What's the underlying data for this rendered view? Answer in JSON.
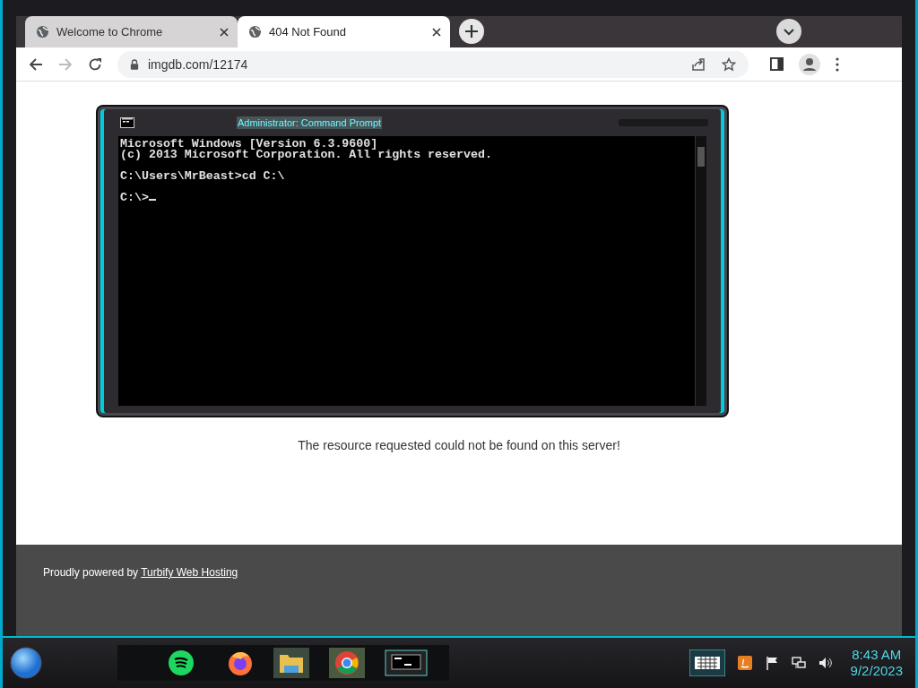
{
  "tabs": [
    {
      "title": "Welcome to Chrome",
      "selected": false
    },
    {
      "title": "404 Not Found",
      "selected": true
    }
  ],
  "toolbar": {
    "back_disabled": false,
    "forward_disabled": true
  },
  "address_bar": {
    "url": "imgdb.com/12174"
  },
  "page": {
    "message": "The resource requested could not be found on this server!",
    "footer_text": "Proudly powered by ",
    "footer_link": "Turbify Web Hosting"
  },
  "console": {
    "title": "Administrator: Command Prompt",
    "blocks": [
      [
        "Microsoft Windows [Version 6.3.9600]",
        "(c) 2013 Microsoft Corporation. All rights reserved."
      ],
      [
        "C:\\Users\\MrBeast>cd C:\\"
      ],
      [
        "C:\\>"
      ]
    ],
    "cursor": true
  },
  "clock": {
    "time": "8:43 AM",
    "date": "9/2/2023"
  }
}
